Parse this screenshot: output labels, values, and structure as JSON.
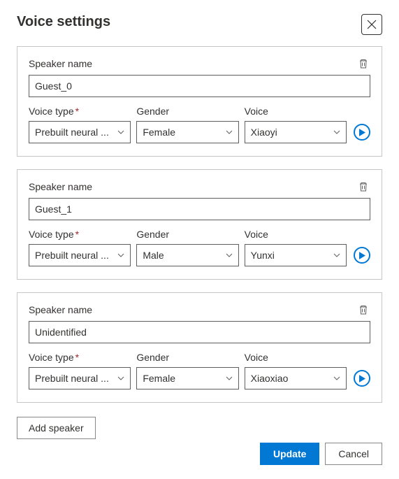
{
  "title": "Voice settings",
  "labels": {
    "speakerName": "Speaker name",
    "voiceType": "Voice type",
    "gender": "Gender",
    "voice": "Voice"
  },
  "speakers": [
    {
      "name": "Guest_0",
      "voiceType": "Prebuilt neural voice",
      "gender": "Female",
      "voice": "Xiaoyi"
    },
    {
      "name": "Guest_1",
      "voiceType": "Prebuilt neural voice",
      "gender": "Male",
      "voice": "Yunxi"
    },
    {
      "name": "Unidentified",
      "voiceType": "Prebuilt neural voice",
      "gender": "Female",
      "voice": "Xiaoxiao"
    }
  ],
  "buttons": {
    "addSpeaker": "Add speaker",
    "update": "Update",
    "cancel": "Cancel"
  }
}
